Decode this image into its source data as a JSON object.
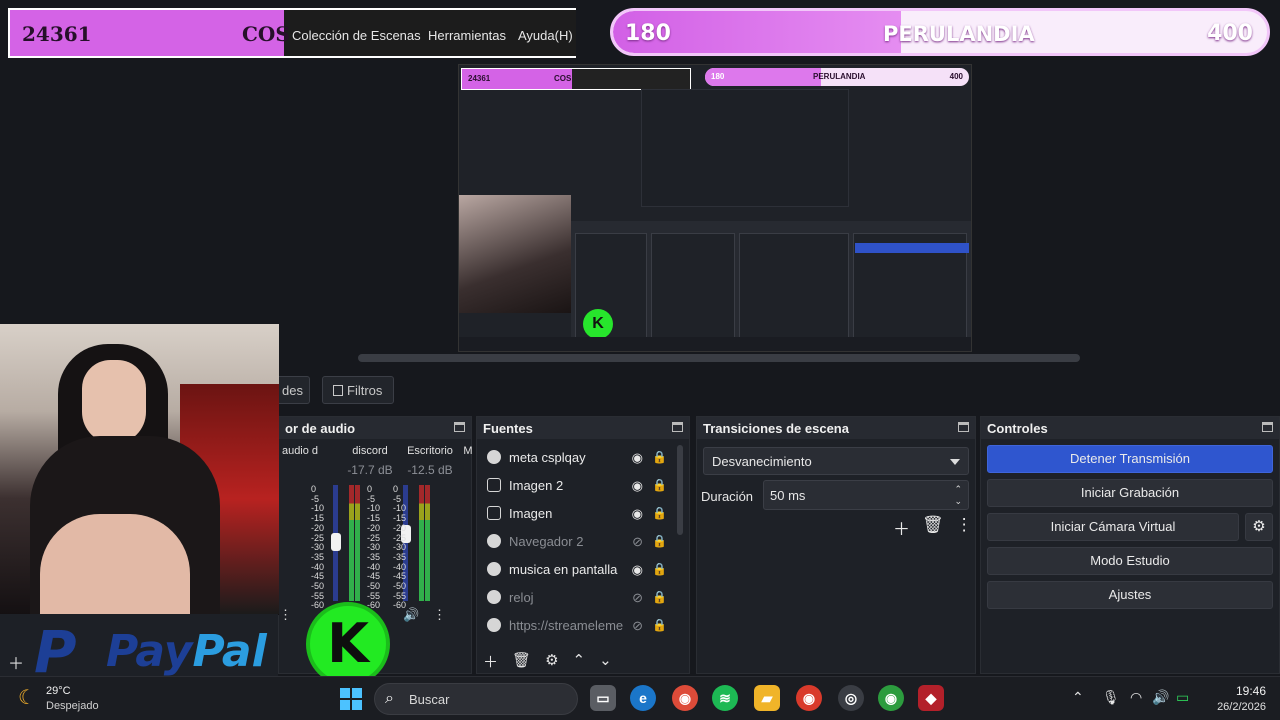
{
  "counter": {
    "value": "24361",
    "label": "COS"
  },
  "obs_menu": {
    "scene_collection": "Colección de Escenas",
    "tools": "Herramientas",
    "help": "Ayuda(H)"
  },
  "goal": {
    "min": "180",
    "title": "PERULANDIA",
    "max": "400",
    "progress_fraction": 0.44
  },
  "tabs": {
    "properties_partial": "des",
    "filters": "Filtros"
  },
  "audio_mixer": {
    "title": "or de audio",
    "channels": [
      {
        "name": "audio d",
        "db": ""
      },
      {
        "name": "discord",
        "db": "-17.7 dB"
      },
      {
        "name": "Escritorio",
        "db": "-12.5 dB"
      },
      {
        "name": "M",
        "db": ""
      }
    ],
    "scale": [
      "0",
      "-5",
      "-10",
      "-15",
      "-20",
      "-25",
      "-30",
      "-35",
      "-40",
      "-45",
      "-50",
      "-55",
      "-60"
    ]
  },
  "sources": {
    "title": "Fuentes",
    "items": [
      {
        "name": "meta csplqay",
        "type": "browser",
        "visible": true,
        "locked": false
      },
      {
        "name": "Imagen 2",
        "type": "image",
        "visible": true,
        "locked": false
      },
      {
        "name": "Imagen",
        "type": "image",
        "visible": true,
        "locked": false
      },
      {
        "name": "Navegador 2",
        "type": "browser",
        "visible": false,
        "locked": false
      },
      {
        "name": "musica en pantalla",
        "type": "browser",
        "visible": true,
        "locked": false
      },
      {
        "name": "reloj",
        "type": "browser",
        "visible": false,
        "locked": false
      },
      {
        "name": "https://streameleme",
        "type": "browser",
        "visible": false,
        "locked": true
      }
    ]
  },
  "transitions": {
    "title": "Transiciones de escena",
    "selected": "Desvanecimiento",
    "duration_label": "Duración",
    "duration_value": "50 ms"
  },
  "controls": {
    "title": "Controles",
    "stop_stream": "Detener Transmisión",
    "start_recording": "Iniciar Grabación",
    "start_virtual_cam": "Iniciar Cámara Virtual",
    "studio_mode": "Modo Estudio",
    "settings": "Ajustes"
  },
  "overlay": {
    "paypal_p": "P",
    "paypal_word_a": "Pay",
    "paypal_word_b": "Pal",
    "k_badge": "K"
  },
  "taskbar": {
    "weather_temp": "29°C",
    "weather_desc": "Despejado",
    "search_placeholder": "Buscar",
    "time": "19:46",
    "date": "26/2/2026"
  },
  "preview_mini": {
    "counter": "24361",
    "label": "COS",
    "goal_min": "180",
    "goal_title": "PERULANDIA",
    "goal_max": "400"
  },
  "colors": {
    "accent": "#2f56cf",
    "overlay_pink": "#d463e6",
    "k_green": "#22ea22",
    "paypal_dark": "#1d3f96",
    "paypal_light": "#2b9de0"
  }
}
